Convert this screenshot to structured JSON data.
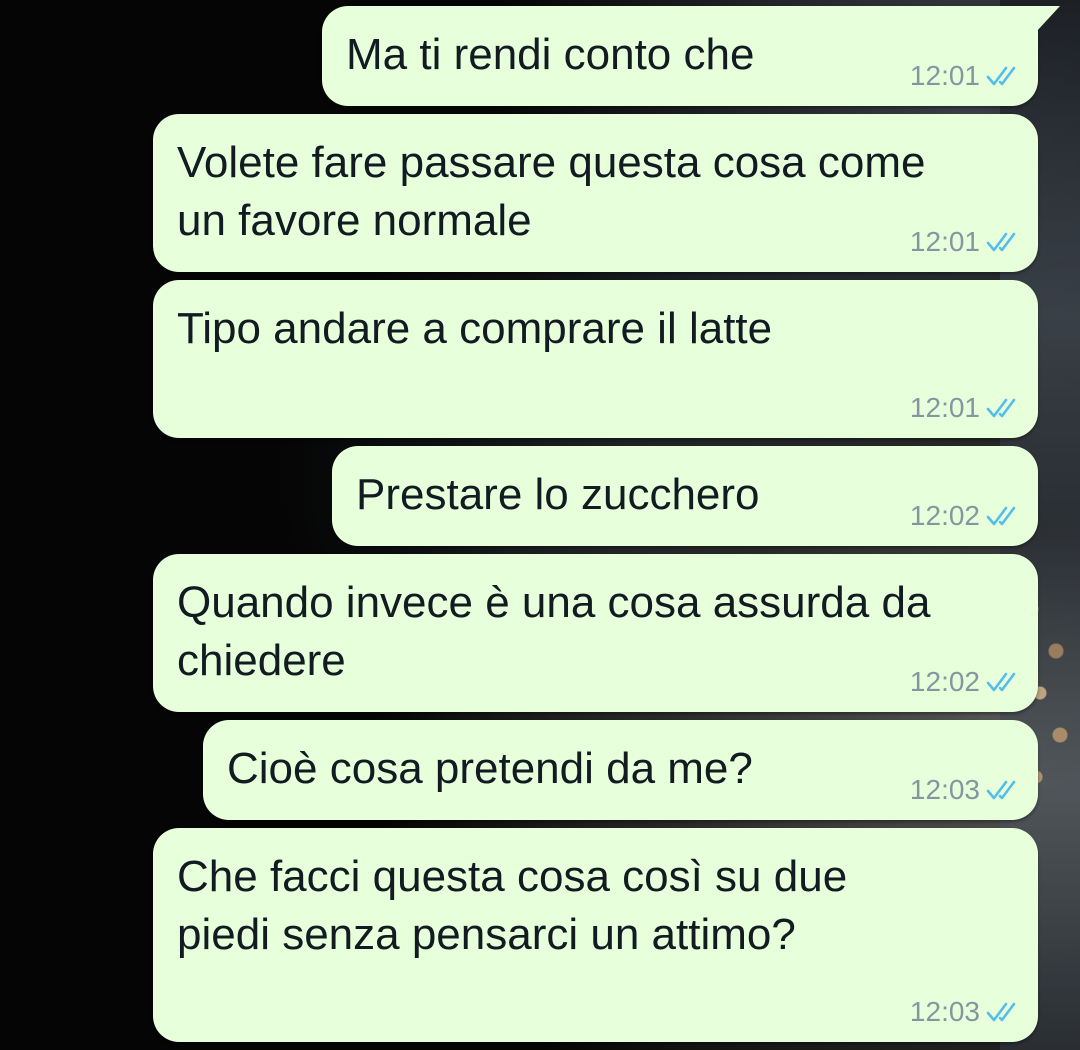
{
  "chat": {
    "messages": [
      {
        "text": "Ma ti rendi conto che",
        "time": "12:01",
        "status": "read"
      },
      {
        "text": "Volete fare passare questa cosa come\nun favore normale",
        "time": "12:01",
        "status": "read"
      },
      {
        "text": "Tipo andare a comprare il latte",
        "time": "12:01",
        "status": "read"
      },
      {
        "text": "Prestare lo zucchero",
        "time": "12:02",
        "status": "read"
      },
      {
        "text": "Quando invece è una cosa assurda da\nchiedere",
        "time": "12:02",
        "status": "read"
      },
      {
        "text": "Cioè cosa pretendi da me?",
        "time": "12:03",
        "status": "read"
      },
      {
        "text": "Che facci questa cosa così su due\npiedi senza pensarci un attimo?",
        "time": "12:03",
        "status": "read"
      }
    ]
  },
  "colors": {
    "outgoing_bubble": "#e7ffdb",
    "timestamp": "#8696a0",
    "read_ticks": "#53bdeb"
  },
  "icons": {
    "read_receipt": "double-check-icon"
  }
}
